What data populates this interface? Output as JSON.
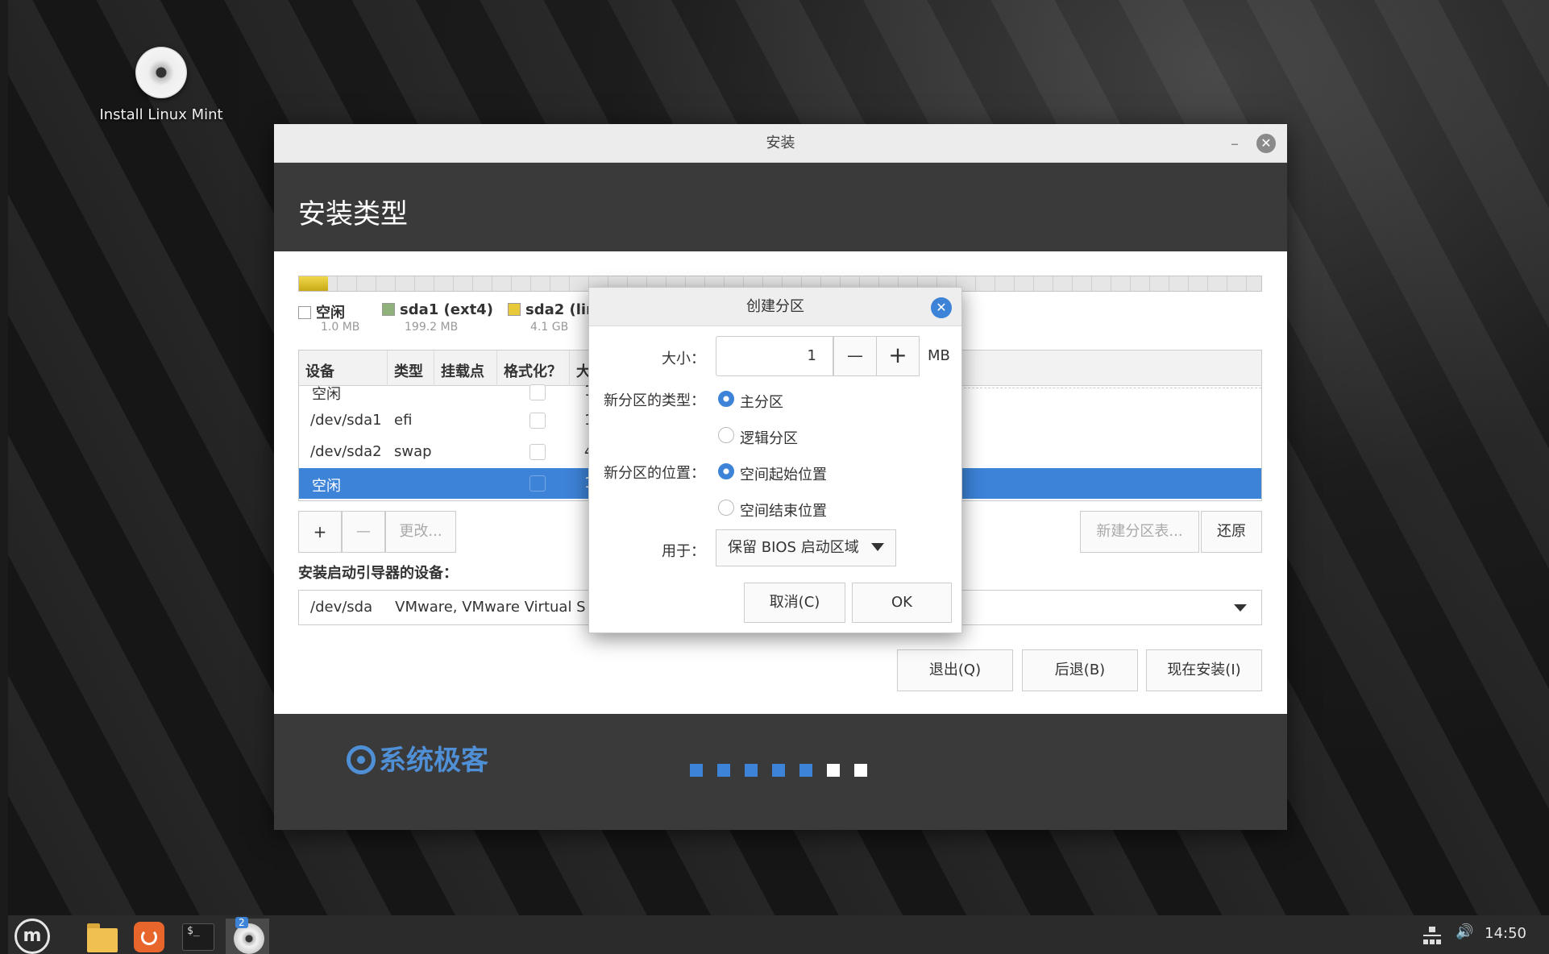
{
  "desktop": {
    "icon_label": "Install Linux Mint"
  },
  "window": {
    "title": "安装",
    "minimize": "–",
    "close": "✕",
    "header": "安装类型"
  },
  "legend": [
    {
      "name": "空闲",
      "size": "1.0 MB",
      "color": "#ffffff"
    },
    {
      "name": "sda1 (ext4)",
      "size": "199.2 MB",
      "color": "#8fb27a"
    },
    {
      "name": "sda2 (lin",
      "size": "4.1 GB",
      "color": "#e8c93a"
    }
  ],
  "table": {
    "headers": [
      "设备",
      "类型",
      "挂载点",
      "格式化？",
      "大"
    ],
    "rows": [
      {
        "device": "空闲",
        "type": "",
        "size": "1"
      },
      {
        "device": "/dev/sda1",
        "type": "efi",
        "size": "1"
      },
      {
        "device": "/dev/sda2",
        "type": "swap",
        "size": "4"
      },
      {
        "device": "空闲",
        "type": "",
        "size": "1"
      }
    ]
  },
  "toolbar": {
    "add": "+",
    "remove": "—",
    "change": "更改...",
    "new_table": "新建分区表...",
    "revert": "还原"
  },
  "bootloader": {
    "label": "安装启动引导器的设备：",
    "device": "/dev/sda",
    "desc": "VMware, VMware Virtual S ("
  },
  "nav": {
    "quit": "退出(Q)",
    "back": "后退(B)",
    "install": "现在安装(I)"
  },
  "footer": {
    "brand": "系统极客",
    "progress_dots": {
      "total": 7,
      "done": 5,
      "done_color": "#3d83d8",
      "todo_color": "#ffffff"
    }
  },
  "dialog": {
    "title": "创建分区",
    "close": "✕",
    "size_label": "大小：",
    "size_value": "1",
    "minus": "—",
    "plus": "+",
    "unit": "MB",
    "type_label": "新分区的类型：",
    "type_primary": "主分区",
    "type_logical": "逻辑分区",
    "location_label": "新分区的位置：",
    "location_start": "空间起始位置",
    "location_end": "空间结束位置",
    "use_label": "用于：",
    "use_value": "保留 BIOS 启动区域",
    "cancel": "取消(C)",
    "ok": "OK"
  },
  "taskbar": {
    "logo": "m",
    "terminal_prompt": "$_",
    "installer_badge": "2",
    "clock": "14:50",
    "volume_icon": "🔊"
  }
}
